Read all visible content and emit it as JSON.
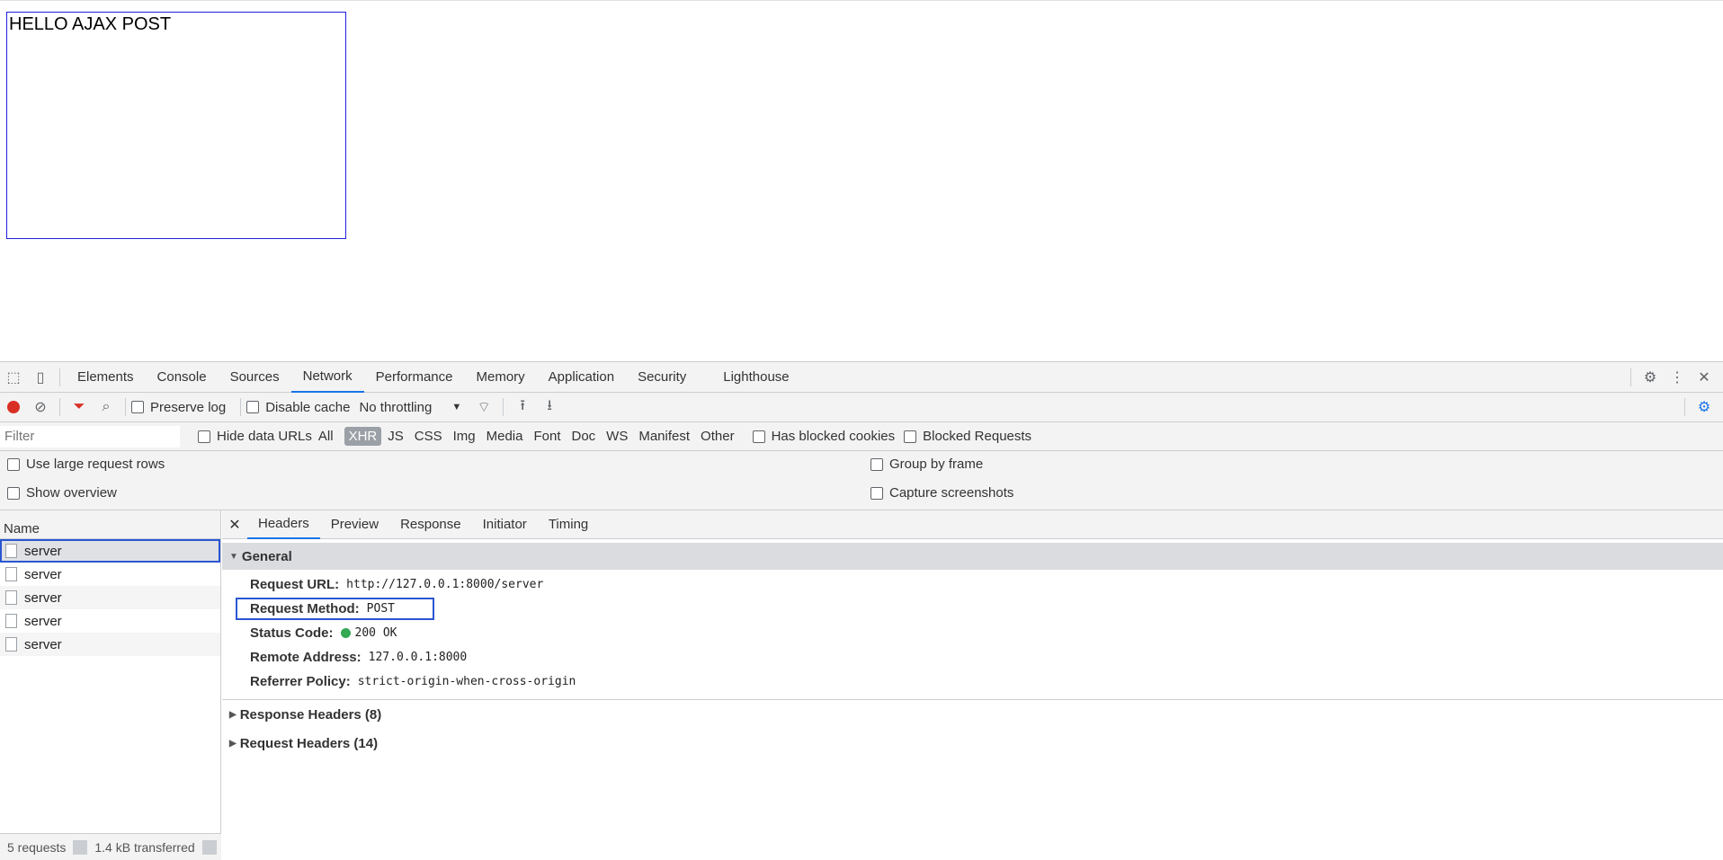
{
  "page": {
    "result_text": "HELLO AJAX POST"
  },
  "devtools": {
    "tabs": [
      "Elements",
      "Console",
      "Sources",
      "Network",
      "Performance",
      "Memory",
      "Application",
      "Security",
      "Lighthouse"
    ],
    "toolbar": {
      "preserve_log": "Preserve log",
      "disable_cache": "Disable cache",
      "throttling": "No throttling"
    },
    "filter": {
      "placeholder": "Filter",
      "hide_data_urls": "Hide data URLs",
      "types": [
        "All",
        "XHR",
        "JS",
        "CSS",
        "Img",
        "Media",
        "Font",
        "Doc",
        "WS",
        "Manifest",
        "Other"
      ],
      "has_blocked_cookies": "Has blocked cookies",
      "blocked_requests": "Blocked Requests"
    },
    "options": {
      "large_rows": "Use large request rows",
      "overview": "Show overview",
      "group_by_frame": "Group by frame",
      "capture_screenshots": "Capture screenshots"
    },
    "requests": {
      "column_name": "Name",
      "items": [
        "server",
        "server",
        "server",
        "server",
        "server"
      ]
    },
    "status": {
      "requests": "5 requests",
      "transferred": "1.4 kB transferred"
    },
    "detail_tabs": [
      "Headers",
      "Preview",
      "Response",
      "Initiator",
      "Timing"
    ],
    "general": {
      "title": "General",
      "request_url_label": "Request URL:",
      "request_url": "http://127.0.0.1:8000/server",
      "request_method_label": "Request Method:",
      "request_method": "POST",
      "status_code_label": "Status Code:",
      "status_code": "200 OK",
      "remote_address_label": "Remote Address:",
      "remote_address": "127.0.0.1:8000",
      "referrer_policy_label": "Referrer Policy:",
      "referrer_policy": "strict-origin-when-cross-origin"
    },
    "response_headers": "Response Headers (8)",
    "request_headers": "Request Headers (14)",
    "colors": {
      "accent": "#1a73e8",
      "highlight": "#2a56d1",
      "status_ok": "#34a853",
      "record": "#d93025"
    }
  }
}
